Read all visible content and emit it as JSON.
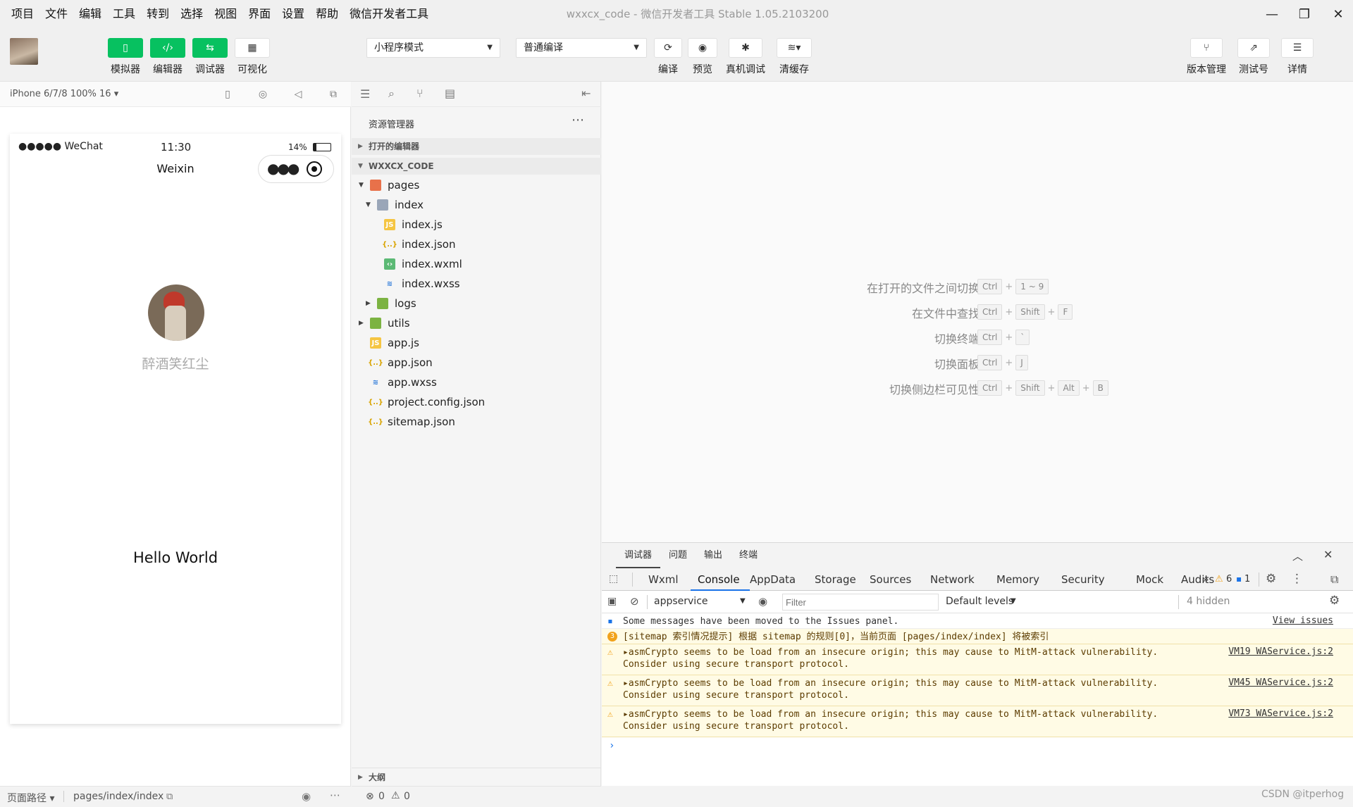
{
  "menubar": {
    "items": [
      "项目",
      "文件",
      "编辑",
      "工具",
      "转到",
      "选择",
      "视图",
      "界面",
      "设置",
      "帮助",
      "微信开发者工具"
    ],
    "title": "wxxcx_code - 微信开发者工具 Stable 1.05.2103200"
  },
  "toolbar": {
    "simulator_label": "模拟器",
    "editor_label": "编辑器",
    "debugger_label": "调试器",
    "visual_label": "可视化",
    "mode_select": "小程序模式",
    "compile_select": "普通编译",
    "compile_label": "编译",
    "preview_label": "预览",
    "remote_debug_label": "真机调试",
    "clear_cache_label": "清缓存",
    "version_label": "版本管理",
    "test_label": "测试号",
    "details_label": "详情"
  },
  "simulator": {
    "device": "iPhone 6/7/8 100% 16 ▾",
    "status": {
      "carrier": "●●●●● WeChat",
      "time": "11:30",
      "battery": "14%"
    },
    "nav_title": "Weixin",
    "nickname": "醉酒笑红尘",
    "hello": "Hello World",
    "footer": {
      "path_label": "页面路径 ▾",
      "path": "pages/index/index"
    }
  },
  "explorer": {
    "title": "资源管理器",
    "open_editors": "打开的编辑器",
    "project": "WXXCX_CODE",
    "tree": [
      {
        "name": "pages",
        "type": "folder",
        "depth": 1,
        "open": true
      },
      {
        "name": "index",
        "type": "folder",
        "depth": 2,
        "open": true
      },
      {
        "name": "index.js",
        "type": "js",
        "depth": 3
      },
      {
        "name": "index.json",
        "type": "json",
        "depth": 3
      },
      {
        "name": "index.wxml",
        "type": "wxml",
        "depth": 3
      },
      {
        "name": "index.wxss",
        "type": "wxss",
        "depth": 3
      },
      {
        "name": "logs",
        "type": "folder",
        "depth": 2,
        "open": false
      },
      {
        "name": "utils",
        "type": "folder",
        "depth": 1,
        "open": false
      },
      {
        "name": "app.js",
        "type": "js",
        "depth": 1
      },
      {
        "name": "app.json",
        "type": "json",
        "depth": 1
      },
      {
        "name": "app.wxss",
        "type": "wxss",
        "depth": 1
      },
      {
        "name": "project.config.json",
        "type": "json",
        "depth": 1
      },
      {
        "name": "sitemap.json",
        "type": "json",
        "depth": 1
      }
    ],
    "outline": "大纲",
    "footer": {
      "errors": "0",
      "warnings": "0"
    }
  },
  "editor": {
    "hints": [
      {
        "label": "在打开的文件之间切换",
        "keys": [
          "Ctrl",
          "1 ~ 9"
        ]
      },
      {
        "label": "在文件中查找",
        "keys": [
          "Ctrl",
          "Shift",
          "F"
        ]
      },
      {
        "label": "切换终端",
        "keys": [
          "Ctrl",
          "`"
        ]
      },
      {
        "label": "切换面板",
        "keys": [
          "Ctrl",
          "J"
        ]
      },
      {
        "label": "切换侧边栏可见性",
        "keys": [
          "Ctrl",
          "Shift",
          "Alt",
          "B"
        ]
      }
    ]
  },
  "devtools": {
    "panel_tabs": [
      "调试器",
      "问题",
      "输出",
      "终端"
    ],
    "tabs": [
      "Wxml",
      "Console",
      "AppData",
      "Storage",
      "Sources",
      "Network",
      "Memory",
      "Security",
      "Mock",
      "Audits"
    ],
    "warn_count": "6",
    "info_count": "1",
    "context": "appservice",
    "filter_placeholder": "Filter",
    "levels": "Default levels",
    "hidden": "4 hidden",
    "messages": [
      {
        "type": "info",
        "text": "Some messages have been moved to the Issues panel.",
        "link": "View issues"
      },
      {
        "type": "sitemap",
        "badge": "3",
        "text": "[sitemap 索引情况提示] 根据 sitemap 的规则[0]，当前页面 [pages/index/index] 将被索引",
        "link": ""
      },
      {
        "type": "warn",
        "text": "▸asmCrypto seems to be load from an insecure origin; this may cause to MitM-attack vulnerability.\nConsider using secure transport protocol.",
        "link": "VM19 WAService.js:2"
      },
      {
        "type": "warn",
        "text": "▸asmCrypto seems to be load from an insecure origin; this may cause to MitM-attack vulnerability.\nConsider using secure transport protocol.",
        "link": "VM45 WAService.js:2"
      },
      {
        "type": "warn",
        "text": "▸asmCrypto seems to be load from an insecure origin; this may cause to MitM-attack vulnerability.\nConsider using secure transport protocol.",
        "link": "VM73 WAService.js:2"
      }
    ],
    "prompt": "›"
  },
  "watermark": "CSDN @itperhog",
  "colors": {
    "accent": "#07c160",
    "link": "#1a73e8",
    "warn_bg": "#fffbe5"
  }
}
